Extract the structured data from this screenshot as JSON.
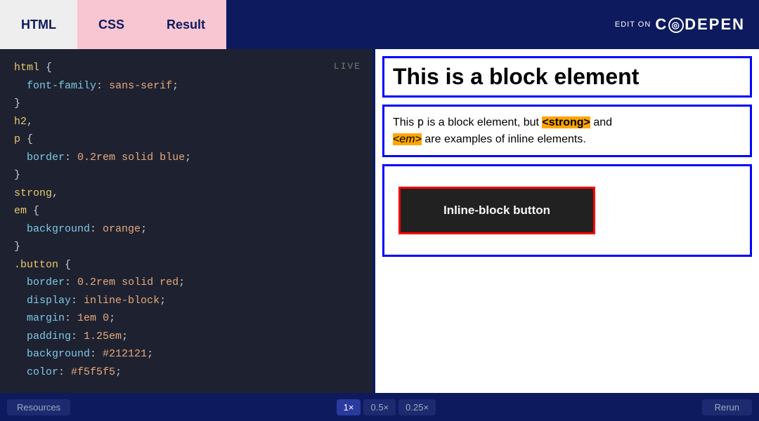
{
  "tabs": {
    "html_label": "HTML",
    "css_label": "CSS",
    "result_label": "Result"
  },
  "header": {
    "edit_on": "EDIT ON",
    "brand": "C◎DEPEN"
  },
  "code": {
    "live_badge": "LIVE",
    "lines": [
      {
        "text": "html {",
        "parts": [
          {
            "t": "html",
            "c": "kw"
          },
          {
            "t": " {",
            "c": "punc"
          }
        ]
      },
      {
        "text": "  font-family: sans-serif;"
      },
      {
        "text": "}"
      },
      {
        "text": "h2,",
        "parts": [
          {
            "t": "h2,",
            "c": "kw"
          }
        ]
      },
      {
        "text": "p {",
        "parts": [
          {
            "t": "p",
            "c": "kw"
          },
          {
            "t": " {",
            "c": "punc"
          }
        ]
      },
      {
        "text": "  border: 0.2rem solid blue;"
      },
      {
        "text": "}"
      },
      {
        "text": "strong,",
        "parts": [
          {
            "t": "strong,",
            "c": "kw"
          }
        ]
      },
      {
        "text": "em {",
        "parts": [
          {
            "t": "em",
            "c": "kw"
          },
          {
            "t": " {",
            "c": "punc"
          }
        ]
      },
      {
        "text": "  background: orange;"
      },
      {
        "text": "}"
      },
      {
        "text": ".button {",
        "parts": [
          {
            "t": ".button",
            "c": "kw"
          },
          {
            "t": " {",
            "c": "punc"
          }
        ]
      },
      {
        "text": "  border: 0.2rem solid red;"
      },
      {
        "text": "  display: inline-block;"
      },
      {
        "text": "  margin: 1em 0;"
      },
      {
        "text": "  padding: 1.25em;"
      },
      {
        "text": "  background: #212121;"
      },
      {
        "text": "  ..."
      }
    ]
  },
  "result": {
    "h2_text": "This is a block element",
    "p_text_before": "This ",
    "p_code": "p",
    "p_text_mid": " is a block element, but ",
    "p_strong": "<strong>",
    "p_text_and": " and",
    "p_em": "<em>",
    "p_text_after": " are examples of inline elements.",
    "button_text": "Inline-block button"
  },
  "bottom": {
    "resources_label": "Resources",
    "zoom_1x": "1×",
    "zoom_05x": "0.5×",
    "zoom_025x": "0.25×",
    "rerun_label": "Rerun"
  }
}
